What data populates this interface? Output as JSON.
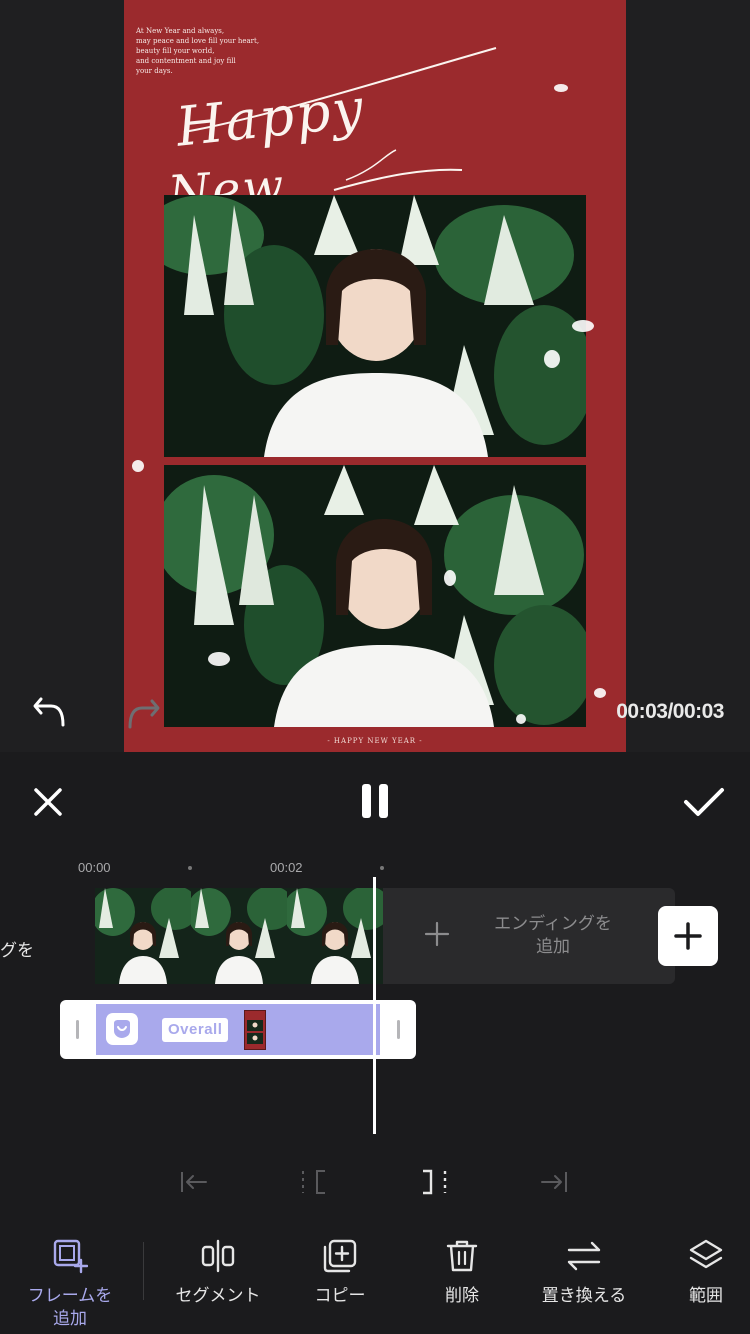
{
  "preview": {
    "poster": {
      "poem": "At New Year and always,\nmay peace and love fill your heart,\nbeauty fill your world,\nand contentment and joy fill\nyour days.",
      "script_line1": "Happy",
      "script_line2": "New",
      "footer": "- HAPPY NEW YEAR -",
      "background_color": "#9b2a2d"
    },
    "time_readout": "00:03/00:03",
    "undo_icon": "undo-arrow-icon",
    "redo_icon": "redo-arrow-icon"
  },
  "header": {
    "close_icon": "close-icon",
    "pause_icon": "pause-icon",
    "confirm_icon": "checkmark-icon"
  },
  "timeline": {
    "ruler": [
      "00:00",
      "00:02"
    ],
    "left_clip_label": "グを",
    "ending": {
      "label": "エンディングを\n追加"
    },
    "overlay": {
      "tag": "Overall",
      "color": "#a9a9ec"
    }
  },
  "toolbar": {
    "items": [
      {
        "label": "フレームを\n追加",
        "icon": "add-frame-icon",
        "active": true
      },
      {
        "label": "セグメント",
        "icon": "segment-icon"
      },
      {
        "label": "コピー",
        "icon": "copy-icon"
      },
      {
        "label": "削除",
        "icon": "trash-icon"
      },
      {
        "label": "置き換える",
        "icon": "replace-icon"
      },
      {
        "label": "範囲",
        "icon": "layers-icon"
      }
    ]
  }
}
